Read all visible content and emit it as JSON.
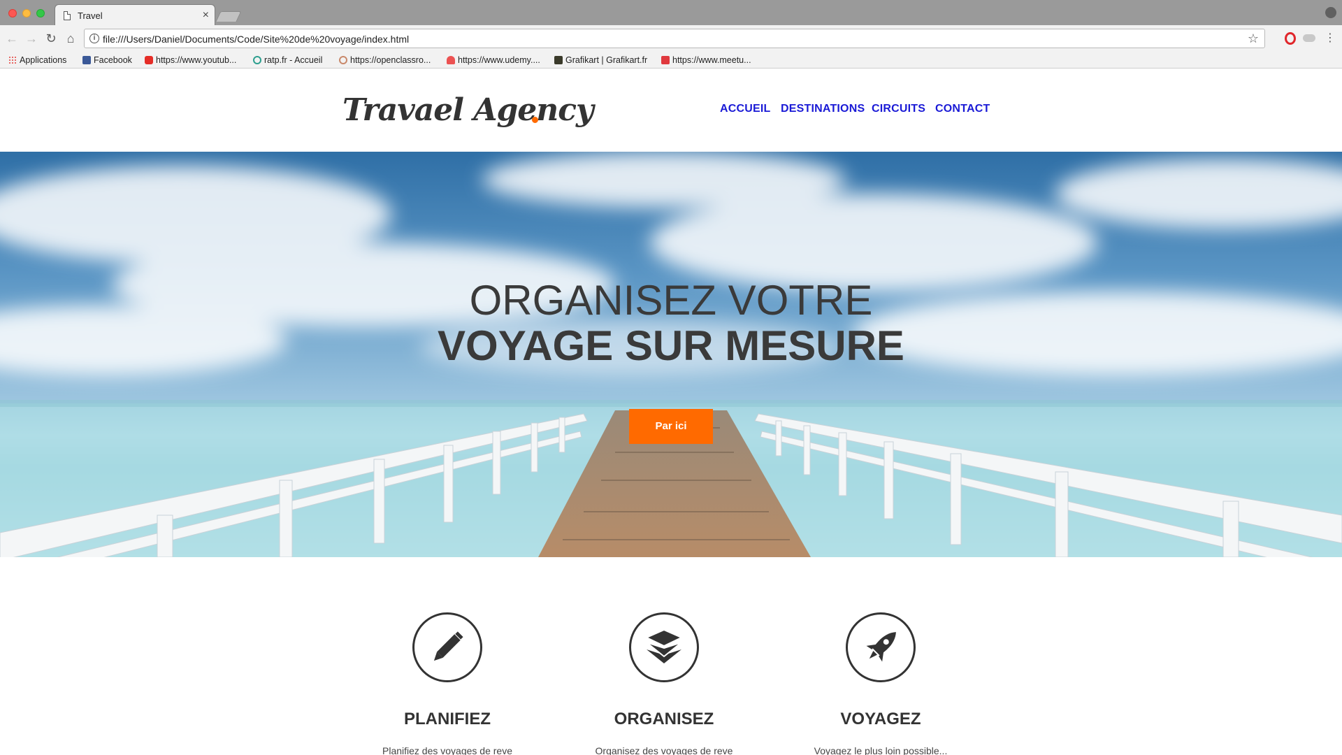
{
  "browser": {
    "tab_title": "Travel",
    "tab_close": "×",
    "url": "file:///Users/Daniel/Documents/Code/Site%20de%20voyage/index.html",
    "bookmarks": [
      {
        "label": "Applications",
        "icon": "apps-grid-icon",
        "color": "#e53935"
      },
      {
        "label": "Facebook",
        "icon": "facebook-icon",
        "color": "#3b5998"
      },
      {
        "label": "https://www.youtub...",
        "icon": "youtube-icon",
        "color": "#e52d27"
      },
      {
        "label": "ratp.fr - Accueil",
        "icon": "ratp-icon",
        "color": "#2e9f8f"
      },
      {
        "label": "https://openclassro...",
        "icon": "openclassrooms-icon",
        "color": "#c9896b"
      },
      {
        "label": "https://www.udemy....",
        "icon": "udemy-icon",
        "color": "#ec5252"
      },
      {
        "label": "Grafikart | Grafikart.fr",
        "icon": "grafikart-icon",
        "color": "#3a3a2a"
      },
      {
        "label": "https://www.meetu...",
        "icon": "meetup-icon",
        "color": "#e0393e"
      }
    ]
  },
  "site": {
    "logo": "Travael Agency",
    "accent": "#ff6a00",
    "nav": [
      "ACCUEIL",
      "DESTINATIONS",
      "CIRCUITS",
      "CONTACT"
    ],
    "nav_color": "#1a1ad6"
  },
  "hero": {
    "title_line1": "ORGANISEZ VOTRE",
    "title_line2": "VOYAGE SUR MESURE",
    "button": "Par ici"
  },
  "features": [
    {
      "icon": "pencil-icon",
      "title": "PLANIFIEZ",
      "text": "Planifiez des voyages de reve"
    },
    {
      "icon": "layers-icon",
      "title": "ORGANISEZ",
      "text": "Organisez des voyages de reve"
    },
    {
      "icon": "rocket-icon",
      "title": "VOYAGEZ",
      "text": "Voyagez le plus loin possible..."
    }
  ]
}
